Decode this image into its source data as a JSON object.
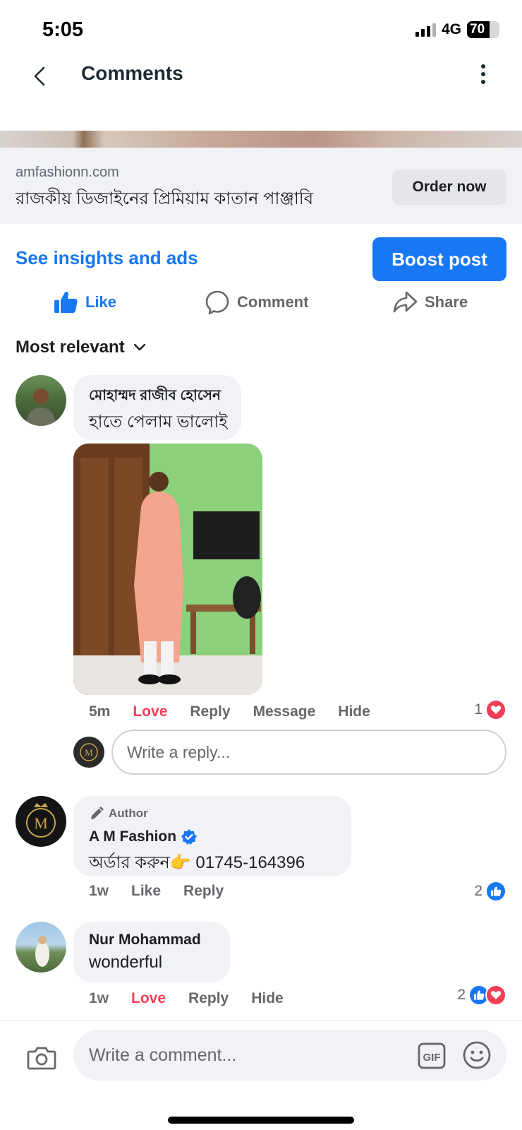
{
  "status": {
    "time": "5:05",
    "network": "4G",
    "battery": "70",
    "battery_level": 0.7
  },
  "nav": {
    "title": "Comments"
  },
  "ad": {
    "domain": "amfashionn.com",
    "title": "রাজকীয় ডিজাইনের প্রিমিয়াম কাতান পাঞ্জাবি",
    "cta": "Order now"
  },
  "insights": {
    "link": "See insights and ads",
    "boost": "Boost post"
  },
  "actions": {
    "like": "Like",
    "comment": "Comment",
    "share": "Share"
  },
  "sort": {
    "label": "Most relevant"
  },
  "comments": [
    {
      "name": "মোহাম্মদ রাজীব হোসেন",
      "text": "হাতে পেলাম ভালোই",
      "time": "5m",
      "actions": [
        "Love",
        "Reply",
        "Message",
        "Hide"
      ],
      "reaction_count": "1"
    },
    {
      "badge": "Author",
      "name": "A M Fashion",
      "text": "অর্ডার করুন👉 01745-164396",
      "time": "1w",
      "actions": [
        "Like",
        "Reply"
      ],
      "reaction_count": "2"
    },
    {
      "name": "Nur Mohammad",
      "text": "wonderful",
      "time": "1w",
      "actions": [
        "Love",
        "Reply",
        "Hide"
      ],
      "reaction_count": "2"
    }
  ],
  "reply_box": {
    "placeholder": "Write a reply..."
  },
  "comment_box": {
    "placeholder": "Write a comment..."
  },
  "logo_text": "M",
  "colors": {
    "accent": "#1877f2",
    "love": "#f33e58",
    "bubble": "#f0f2f5",
    "muted": "#65676b"
  }
}
